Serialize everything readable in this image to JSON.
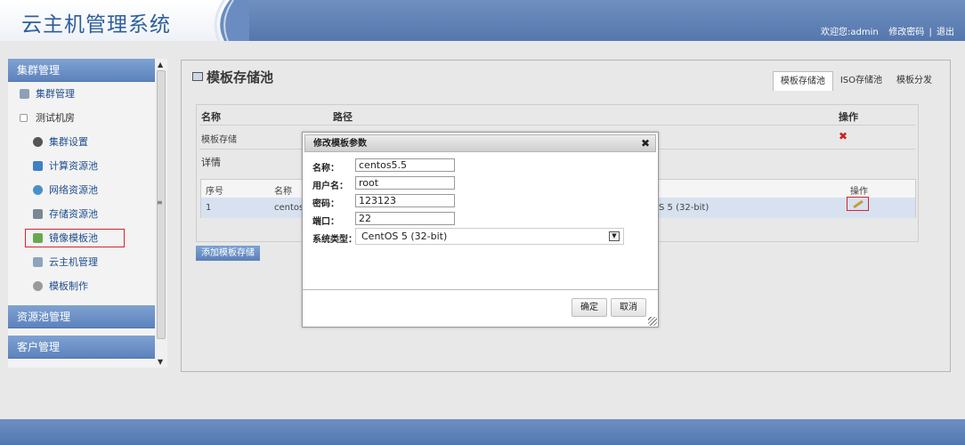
{
  "header": {
    "title": "云主机管理系统",
    "welcome": "欢迎您:admin",
    "change_password": "修改密码",
    "separator": "|",
    "logout": "退出"
  },
  "sidebar": {
    "groups": [
      {
        "label": "集群管理"
      },
      {
        "label": "资源池管理"
      },
      {
        "label": "客户管理"
      }
    ],
    "items": [
      {
        "label": "集群管理",
        "icon": "cluster-icon"
      },
      {
        "label": "测试机房",
        "icon": "expand-icon"
      },
      {
        "label": "集群设置",
        "icon": "gear-icon"
      },
      {
        "label": "计算资源池",
        "icon": "compute-icon"
      },
      {
        "label": "网络资源池",
        "icon": "globe-icon"
      },
      {
        "label": "存储资源池",
        "icon": "storage-icon"
      },
      {
        "label": "镜像模板池",
        "icon": "image-icon"
      },
      {
        "label": "云主机管理",
        "icon": "vm-icon"
      },
      {
        "label": "模板制作",
        "icon": "disc-icon"
      }
    ]
  },
  "main": {
    "title": "模板存储池",
    "tabs": [
      {
        "label": "模板存储池",
        "active": true
      },
      {
        "label": "ISO存储池",
        "active": false
      },
      {
        "label": "模板分发",
        "active": false
      }
    ],
    "table": {
      "col_name": "名称",
      "col_path": "路径",
      "col_ops": "操作",
      "row_name": "模板存储",
      "detail_label": "详情"
    },
    "detail_table": {
      "col_index": "序号",
      "col_name": "名称",
      "col_ops": "操作",
      "row_index": "1",
      "row_name": "centos",
      "row_os": "S 5 (32-bit)"
    },
    "add_button": "添加模板存储"
  },
  "dialog": {
    "title": "修改模板参数",
    "close": "✖",
    "fields": {
      "name_label": "名称：",
      "name_value": "centos5.5",
      "user_label": "用户名：",
      "user_value": "root",
      "password_label": "密码：",
      "password_value": "123123",
      "port_label": "端口：",
      "port_value": "22",
      "os_label": "系统类型：",
      "os_value": "CentOS 5 (32-bit)"
    },
    "ok": "确定",
    "cancel": "取消"
  },
  "colors": {
    "header_blue": "#5a7eb5",
    "title_blue": "#2f5f9b",
    "highlight_red": "#d9232d",
    "row_selected": "#d7e1f0"
  }
}
